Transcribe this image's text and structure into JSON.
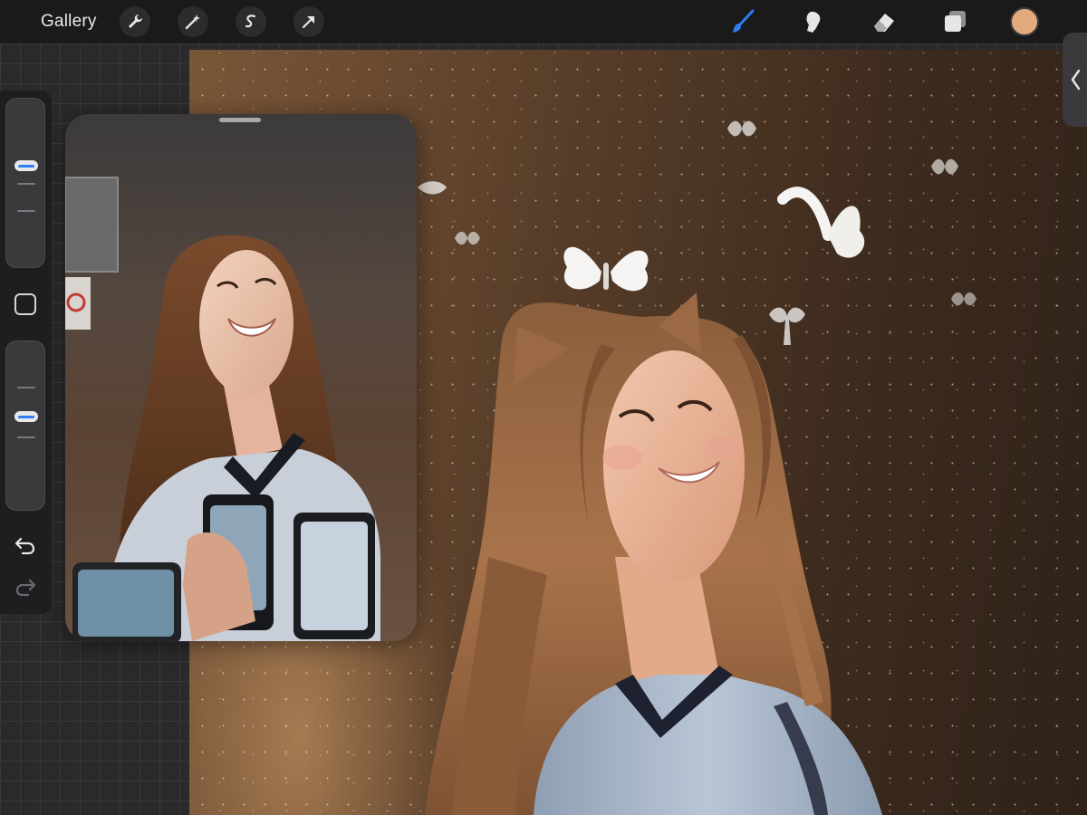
{
  "toolbar": {
    "gallery_label": "Gallery",
    "left_tools": [
      "wrench-icon",
      "magic-wand-icon",
      "selection-icon",
      "transform-arrow-icon"
    ],
    "right_tools": [
      "brush-icon",
      "smudge-icon",
      "eraser-icon",
      "layers-icon"
    ],
    "active_tool": "brush-icon",
    "accent_color": "#2f7cf6",
    "current_color": "#e3aa7e"
  },
  "sidebar": {
    "controls": [
      "brush-size-slider",
      "modify-button",
      "opacity-slider",
      "undo-icon",
      "redo-icon"
    ]
  },
  "colors": {
    "toolbar_bg": "#1a1a1b",
    "canvas_warm": "#7a5638",
    "canvas_dark": "#2f2218",
    "hair": "#9a6a45",
    "shirt": "#a8b6c8"
  }
}
